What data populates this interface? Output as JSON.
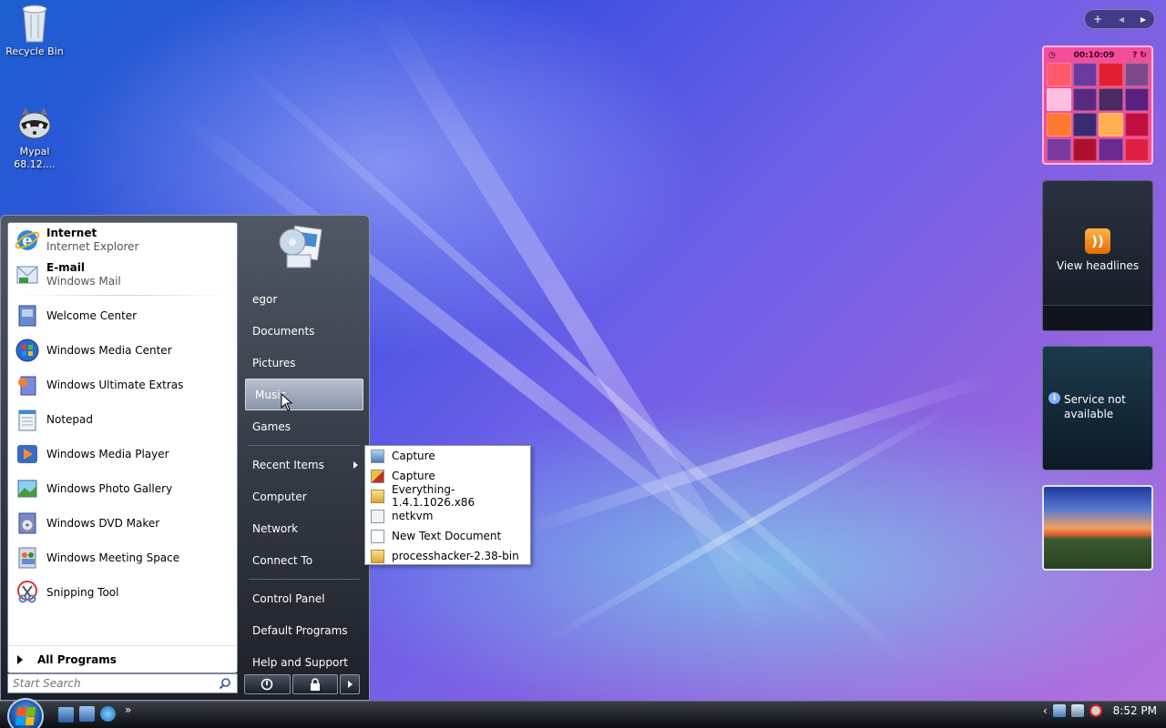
{
  "desktop": {
    "icons": [
      {
        "label": "Recycle Bin",
        "icon": "recycle-bin-icon"
      },
      {
        "label": "Mypal\n68.12....",
        "icon": "mypal-raccoon-icon"
      }
    ]
  },
  "start_menu": {
    "pinned": [
      {
        "title": "Internet",
        "subtitle": "Internet Explorer",
        "icon": "internet-explorer-icon"
      },
      {
        "title": "E-mail",
        "subtitle": "Windows Mail",
        "icon": "windows-mail-icon"
      }
    ],
    "recent_programs": [
      {
        "label": "Welcome Center",
        "icon": "welcome-center-icon"
      },
      {
        "label": "Windows Media Center",
        "icon": "media-center-icon"
      },
      {
        "label": "Windows Ultimate Extras",
        "icon": "ultimate-extras-icon"
      },
      {
        "label": "Notepad",
        "icon": "notepad-icon"
      },
      {
        "label": "Windows Media Player",
        "icon": "media-player-icon"
      },
      {
        "label": "Windows Photo Gallery",
        "icon": "photo-gallery-icon"
      },
      {
        "label": "Windows DVD Maker",
        "icon": "dvd-maker-icon"
      },
      {
        "label": "Windows Meeting Space",
        "icon": "meeting-space-icon"
      },
      {
        "label": "Snipping Tool",
        "icon": "snipping-tool-icon"
      }
    ],
    "all_programs_label": "All Programs",
    "search_placeholder": "Start Search",
    "right_items": {
      "user": "egor",
      "documents": "Documents",
      "pictures": "Pictures",
      "music": "Music",
      "games": "Games",
      "recent_items": "Recent Items",
      "computer": "Computer",
      "network": "Network",
      "connect_to": "Connect To",
      "control_panel": "Control Panel",
      "default_programs": "Default Programs",
      "help_support": "Help and Support"
    },
    "recent_items_submenu": [
      {
        "label": "Capture",
        "icon": "image-file-icon"
      },
      {
        "label": "Capture",
        "icon": "image-file-icon"
      },
      {
        "label": "Everything-1.4.1.1026.x86",
        "icon": "folder-icon"
      },
      {
        "label": "netkvm",
        "icon": "config-file-icon"
      },
      {
        "label": "New Text Document",
        "icon": "text-file-icon"
      },
      {
        "label": "processhacker-2.38-bin",
        "icon": "folder-icon"
      }
    ]
  },
  "gadgets": {
    "puzzle_timer": "00:10:09",
    "feed_label": "View headlines",
    "weather_status": "Service not available"
  },
  "taskbar": {
    "clock": "8:52 PM",
    "overflow": "»"
  },
  "colors": {
    "accent": "#1c5fd0",
    "puzzle": "#f44d9a"
  }
}
